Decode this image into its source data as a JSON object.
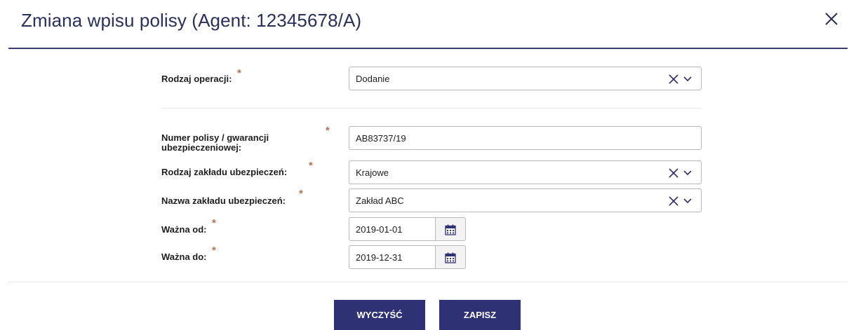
{
  "dialog": {
    "title": "Zmiana wpisu polisy (Agent: 12345678/A)",
    "close_icon": "close-icon"
  },
  "form": {
    "operation": {
      "label": "Rodzaj operacji:",
      "required": "*",
      "value": "Dodanie"
    },
    "policy_number": {
      "label_line1": "Numer polisy / gwarancji",
      "label_line2": "ubezpieczeniowej:",
      "required": "*",
      "value": "AB83737/19"
    },
    "insurer_type": {
      "label": "Rodzaj zakładu ubezpieczeń:",
      "required": "*",
      "value": "Krajowe"
    },
    "insurer_name": {
      "label": "Nazwa zakładu ubezpieczeń:",
      "required": "*",
      "value": "Zakład ABC"
    },
    "valid_from": {
      "label": "Ważna od:",
      "required": "*",
      "value": "2019-01-01"
    },
    "valid_to": {
      "label": "Ważna do:",
      "required": "*",
      "value": "2019-12-31"
    }
  },
  "buttons": {
    "clear": "WYCZYŚĆ",
    "save": "ZAPISZ"
  },
  "colors": {
    "primary": "#2e3173",
    "required_marker": "#b87050",
    "title": "#2b2f5c"
  }
}
